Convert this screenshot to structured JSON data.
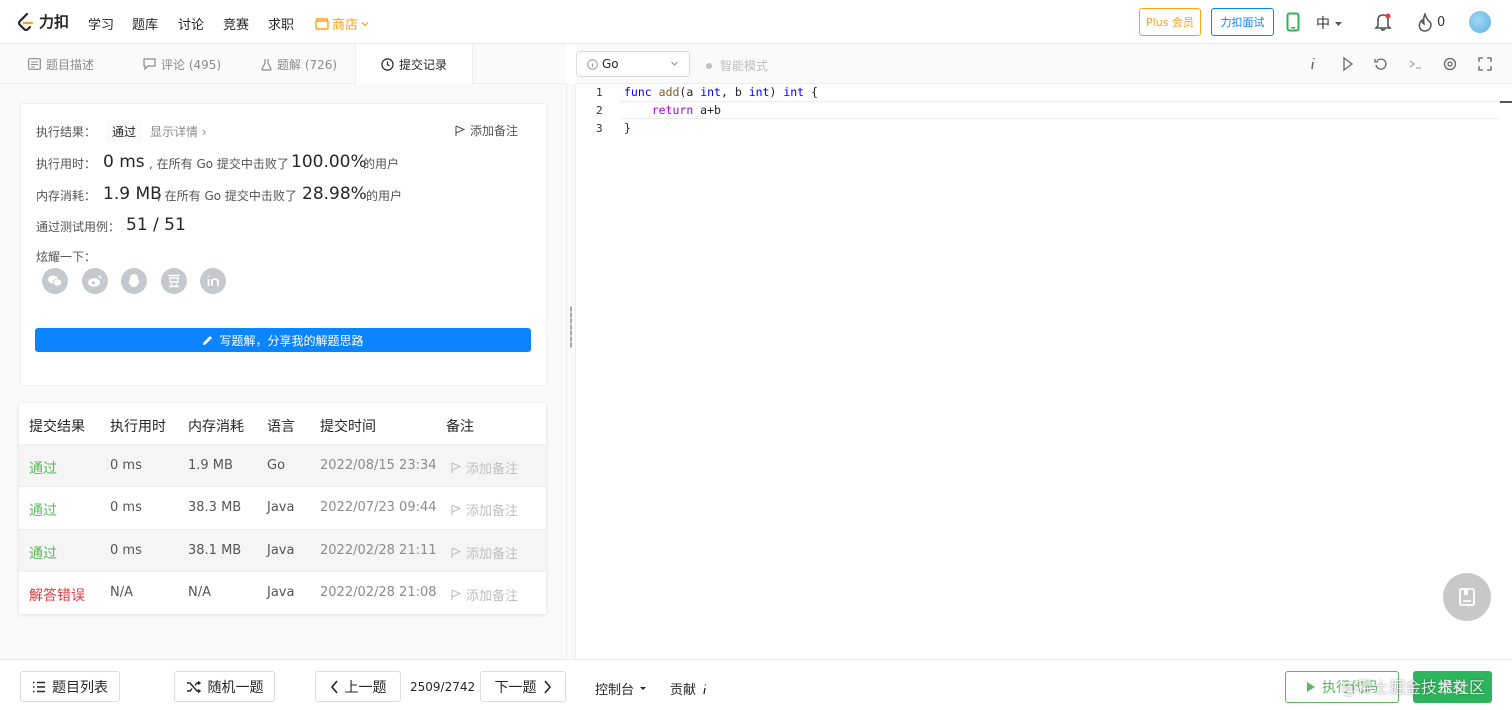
{
  "nav": {
    "logo_text": "力扣",
    "items": [
      "学习",
      "题库",
      "讨论",
      "竞赛",
      "求职"
    ],
    "store": "商店",
    "plus": "Plus 会员",
    "interview": "力扣面试",
    "lang": "中",
    "streak": "0",
    "brand_color": "#ffa116"
  },
  "tabs": [
    {
      "label": "题目描述",
      "icon": "description-icon"
    },
    {
      "label": "评论 (495)",
      "icon": "comment-icon"
    },
    {
      "label": "题解 (726)",
      "icon": "flask-icon"
    },
    {
      "label": "提交记录",
      "icon": "clock-icon"
    }
  ],
  "editor_bar": {
    "language": "Go",
    "smart_mode": "智能模式"
  },
  "result": {
    "exec_result_label": "执行结果：",
    "status": "通过",
    "show_detail": "显示详情 ›",
    "add_note": "添加备注",
    "runtime_label": "执行用时：",
    "runtime": "0 ms",
    "runtime_beat_text": ", 在所有 Go 提交中击败了",
    "runtime_pct": "100.00%",
    "users_suffix": "的用户",
    "memory_label": "内存消耗：",
    "memory": "1.9 MB",
    "memory_beat_text": ", 在所有 Go 提交中击败了",
    "memory_pct": "28.98%",
    "tests_label": "通过测试用例：",
    "tests": "51 / 51",
    "share_label": "炫耀一下：",
    "share_icons": [
      "wechat-icon",
      "weibo-icon",
      "qq-icon",
      "douban-icon",
      "linkedin-icon"
    ],
    "write_solution": "写题解，分享我的解题思路"
  },
  "table": {
    "headers": [
      "提交结果",
      "执行用时",
      "内存消耗",
      "语言",
      "提交时间",
      "备注"
    ],
    "rows": [
      {
        "result": "通过",
        "time": "0 ms",
        "memory": "1.9 MB",
        "lang": "Go",
        "date": "2022/08/15 23:34",
        "note": "添加备注"
      },
      {
        "result": "通过",
        "time": "0 ms",
        "memory": "38.3 MB",
        "lang": "Java",
        "date": "2022/07/23 09:44",
        "note": "添加备注"
      },
      {
        "result": "通过",
        "time": "0 ms",
        "memory": "38.1 MB",
        "lang": "Java",
        "date": "2022/02/28 21:11",
        "note": "添加备注"
      },
      {
        "result": "解答错误",
        "time": "N/A",
        "memory": "N/A",
        "lang": "Java",
        "date": "2022/02/28 21:08",
        "note": "添加备注"
      }
    ]
  },
  "code": {
    "line_numbers": [
      "1",
      "2",
      "3"
    ]
  },
  "bottom": {
    "problem_list": "题目列表",
    "random": "随机一题",
    "prev": "上一题",
    "page": "2509/2742",
    "next": "下一题",
    "console": "控制台",
    "contribute": "贡献",
    "run": "执行代码",
    "submit": "提交",
    "watermark": "@稀土掘金技术社区"
  }
}
